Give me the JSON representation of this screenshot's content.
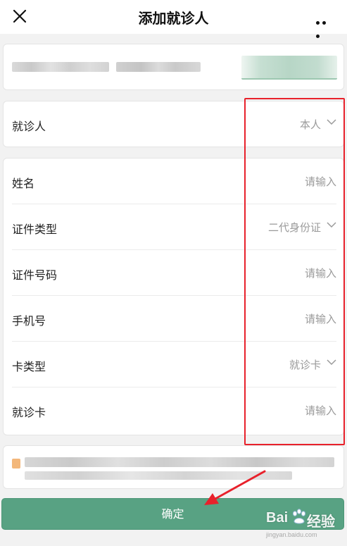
{
  "header": {
    "title": "添加就诊人"
  },
  "patient_select": {
    "label": "就诊人",
    "value": "本人"
  },
  "form": {
    "rows": [
      {
        "label": "姓名",
        "value": "请输入",
        "type": "input"
      },
      {
        "label": "证件类型",
        "value": "二代身份证",
        "type": "select"
      },
      {
        "label": "证件号码",
        "value": "请输入",
        "type": "input"
      },
      {
        "label": "手机号",
        "value": "请输入",
        "type": "input"
      },
      {
        "label": "卡类型",
        "value": "就诊卡",
        "type": "select"
      },
      {
        "label": "就诊卡",
        "value": "请输入",
        "type": "input"
      }
    ]
  },
  "confirm_label": "确定",
  "watermark": {
    "brand_left": "Bai",
    "brand_right": "经验",
    "url": "jingyan.baidu.com"
  },
  "colors": {
    "primary_green": "#58a283",
    "annotation_red": "#e8212b"
  }
}
